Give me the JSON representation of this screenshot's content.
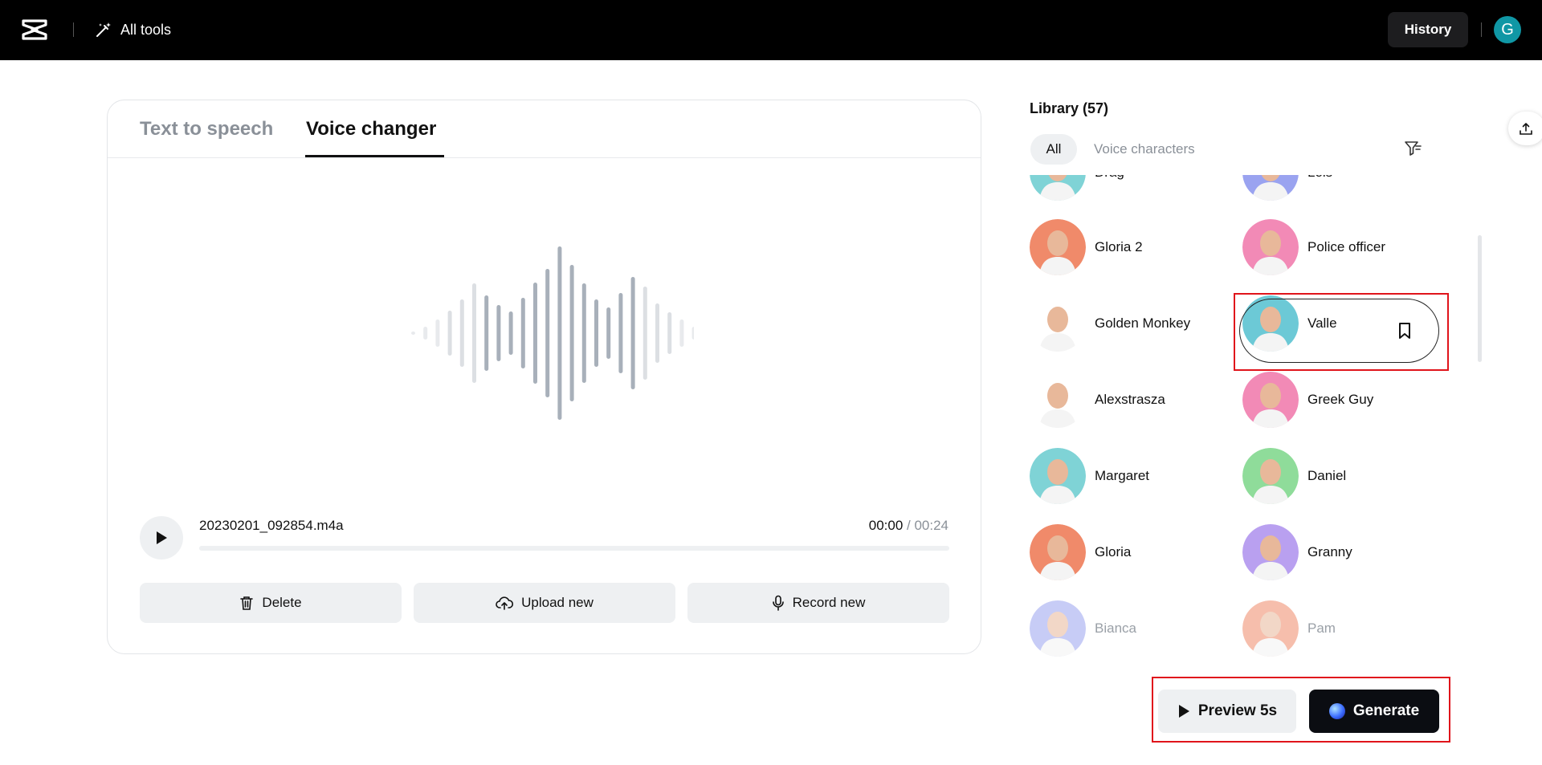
{
  "topbar": {
    "all_tools_label": "All tools",
    "history_label": "History",
    "avatar_initial": "G",
    "avatar_color": "#1097a5"
  },
  "tabs": [
    {
      "label": "Text to speech",
      "active": false
    },
    {
      "label": "Voice changer",
      "active": true
    }
  ],
  "player": {
    "filename": "20230201_092854.m4a",
    "current_time": "00:00",
    "separator": " / ",
    "total_time": "00:24",
    "progress": 0
  },
  "actions": {
    "delete_label": "Delete",
    "upload_label": "Upload new",
    "record_label": "Record new"
  },
  "library": {
    "title": "Library (57)",
    "filters": [
      {
        "label": "All",
        "active": true
      },
      {
        "label": "Voice characters",
        "active": false
      }
    ],
    "voices": [
      {
        "name": "Drag",
        "bg": "#7fd3d6",
        "faded": false
      },
      {
        "name": "Lois",
        "bg": "#9aa3f0",
        "faded": false
      },
      {
        "name": "Gloria 2",
        "bg": "#f08a6a",
        "faded": false
      },
      {
        "name": "Police officer",
        "bg": "#f28ab6",
        "faded": false
      },
      {
        "name": "Golden Monkey",
        "bg": "#ffffff",
        "faded": false
      },
      {
        "name": "Valley girl",
        "bg": "#6cc9d6",
        "faded": false,
        "selected": true
      },
      {
        "name": "Alexstrasza",
        "bg": "#ffffff",
        "faded": false
      },
      {
        "name": "Greek Guy",
        "bg": "#f28ab6",
        "faded": false
      },
      {
        "name": "Margaret",
        "bg": "#7fd3d6",
        "faded": false
      },
      {
        "name": "Daniel",
        "bg": "#8fdc9a",
        "faded": false
      },
      {
        "name": "Gloria",
        "bg": "#f08a6a",
        "faded": false
      },
      {
        "name": "Granny",
        "bg": "#b9a0f0",
        "faded": false
      },
      {
        "name": "Bianca",
        "bg": "#9aa3f0",
        "faded": true
      },
      {
        "name": "Pam",
        "bg": "#f08a6a",
        "faded": true
      }
    ],
    "selected_display_name": "Valle"
  },
  "footer": {
    "preview_label": "Preview 5s",
    "generate_label": "Generate"
  },
  "colors": {
    "highlight_box": "#e0141b",
    "accent_dark": "#0b0d12",
    "muted_bg": "#eef0f2"
  }
}
